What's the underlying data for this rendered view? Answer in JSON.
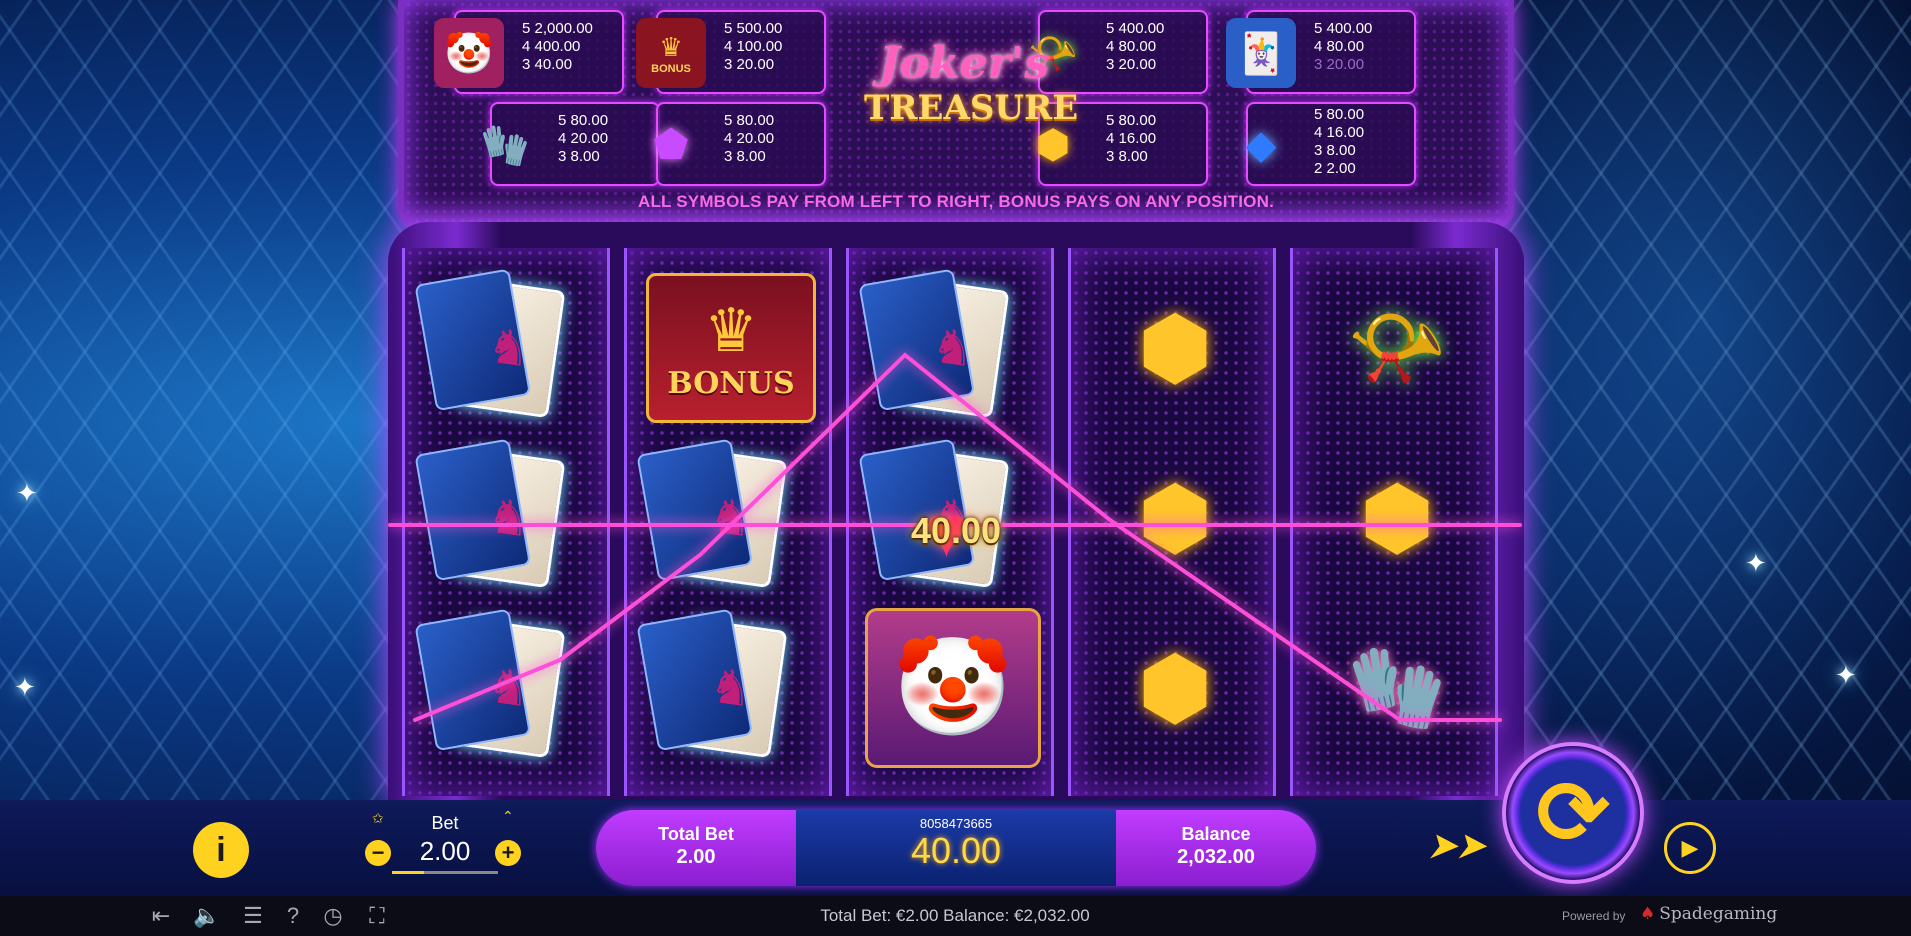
{
  "paytable": {
    "entries": [
      {
        "symbol": "jester-icon",
        "lines": [
          [
            "5",
            "2,000.00"
          ],
          [
            "4",
            "400.00"
          ],
          [
            "3",
            "40.00"
          ]
        ]
      },
      {
        "symbol": "bonus-crown-icon",
        "badge": "BONUS",
        "lines": [
          [
            "5",
            "500.00"
          ],
          [
            "4",
            "100.00"
          ],
          [
            "3",
            "20.00"
          ]
        ]
      },
      {
        "symbol": "horn-icon",
        "lines": [
          [
            "5",
            "400.00"
          ],
          [
            "4",
            "80.00"
          ],
          [
            "3",
            "20.00"
          ]
        ]
      },
      {
        "symbol": "joker-card-icon",
        "lines": [
          [
            "5",
            "400.00"
          ],
          [
            "4",
            "80.00"
          ],
          [
            "3",
            "20.00"
          ]
        ]
      },
      {
        "symbol": "gloves-icon",
        "lines": [
          [
            "5",
            "80.00"
          ],
          [
            "4",
            "20.00"
          ],
          [
            "3",
            "8.00"
          ]
        ]
      },
      {
        "symbol": "purple-gem-icon",
        "lines": [
          [
            "5",
            "80.00"
          ],
          [
            "4",
            "20.00"
          ],
          [
            "3",
            "8.00"
          ]
        ]
      },
      {
        "symbol": "yellow-gem-icon",
        "lines": [
          [
            "5",
            "80.00"
          ],
          [
            "4",
            "16.00"
          ],
          [
            "3",
            "8.00"
          ]
        ]
      },
      {
        "symbol": "blue-gem-icon",
        "lines": [
          [
            "5",
            "80.00"
          ],
          [
            "4",
            "16.00"
          ],
          [
            "3",
            "8.00"
          ],
          [
            "2",
            "2.00"
          ]
        ]
      }
    ],
    "note": "ALL SYMBOLS PAY FROM LEFT TO RIGHT, BONUS PAYS ON ANY POSITION."
  },
  "logo": {
    "title": "Joker's",
    "subtitle": "TREASURE"
  },
  "reels": [
    [
      "joker-card-icon",
      "joker-card-icon",
      "joker-card-icon"
    ],
    [
      "bonus-crown-icon",
      "joker-card-icon",
      "joker-card-icon"
    ],
    [
      "joker-card-icon",
      "joker-card-icon",
      "jester-icon"
    ],
    [
      "yellow-gem-icon",
      "yellow-gem-icon",
      "yellow-gem-icon"
    ],
    [
      "horn-icon",
      "yellow-gem-icon",
      "gloves-icon"
    ]
  ],
  "symbol_labels": {
    "bonus": "BONUS"
  },
  "win": {
    "amount": "40.00",
    "line_color": "#ff4fd8"
  },
  "controls": {
    "bet_label": "Bet",
    "bet_value": "2.00",
    "total_bet_label": "Total Bet",
    "total_bet_value": "2.00",
    "round_id": "8058473665",
    "win_value": "40.00",
    "balance_label": "Balance",
    "balance_value": "2,032.00"
  },
  "footer": {
    "status_text": "Total Bet: €2.00  Balance: €2,032.00",
    "powered_by": "Powered by",
    "brand": "Spadegaming"
  },
  "colors": {
    "accent": "#ffd21f",
    "neon": "#e64bff",
    "panel": "#2c0e56"
  }
}
